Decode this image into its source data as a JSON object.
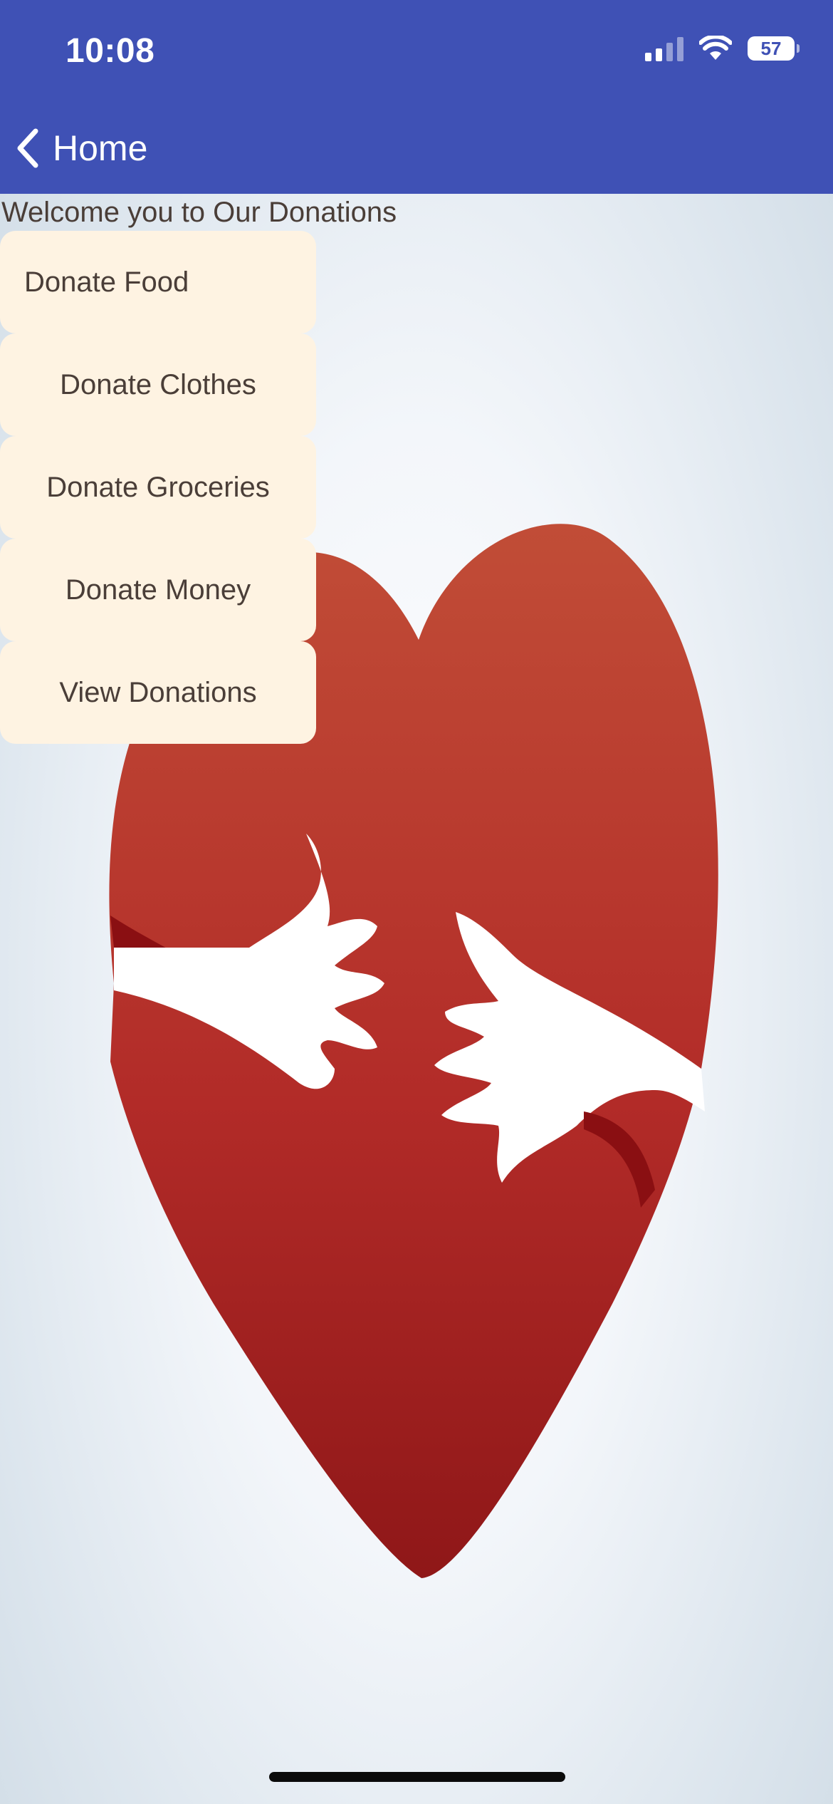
{
  "status_bar": {
    "time": "10:08",
    "battery": "57",
    "icons": [
      "cellular-signal-icon",
      "wifi-icon",
      "battery-icon"
    ]
  },
  "nav": {
    "back_label": "Home",
    "back_icon": "chevron-left-icon"
  },
  "main": {
    "welcome_text": "Welcome you to Our Donations",
    "menu": [
      {
        "label": "Donate Food"
      },
      {
        "label": "Donate Clothes"
      },
      {
        "label": "Donate Groceries"
      },
      {
        "label": "Donate Money"
      },
      {
        "label": "View Donations"
      }
    ],
    "hero_image": "heart-with-hands-illustration"
  },
  "colors": {
    "header": "#3f51b5",
    "button_bg": "#fef3e2",
    "text": "#4a3e38",
    "heart": "#b8302c"
  }
}
